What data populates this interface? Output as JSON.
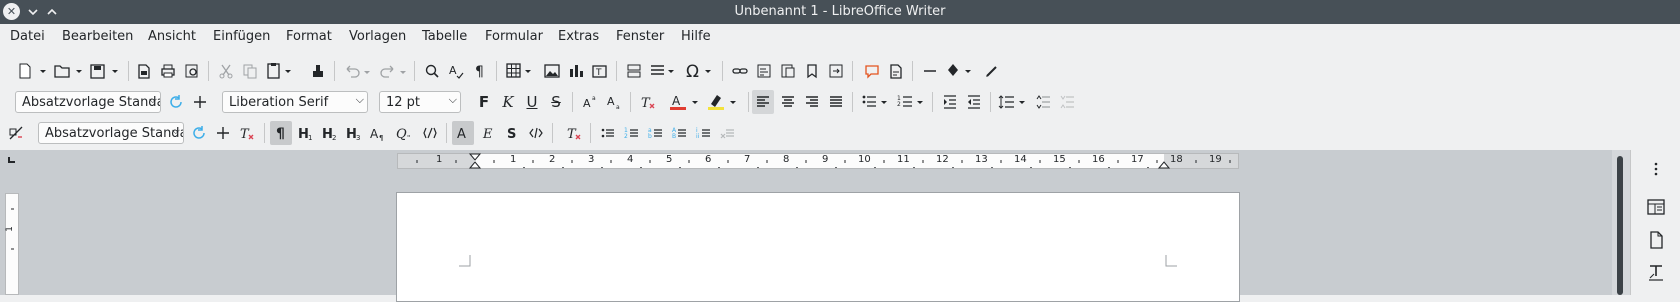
{
  "window": {
    "title": "Unbenannt 1 - LibreOffice Writer"
  },
  "menubar": {
    "items": [
      "Datei",
      "Bearbeiten",
      "Ansicht",
      "Einfügen",
      "Format",
      "Vorlagen",
      "Tabelle",
      "Formular",
      "Extras",
      "Fenster",
      "Hilfe"
    ]
  },
  "formatting_toolbar": {
    "paragraph_style": "Absatzvorlage Standard",
    "font_name": "Liberation Serif",
    "font_size": "12 pt",
    "bold_glyph": "F",
    "italic_glyph": "K",
    "underline_glyph": "U",
    "strike_glyph": "S"
  },
  "sidebar_style_toolbar": {
    "paragraph_style": "Absatzvorlage Standard"
  },
  "ruler": {
    "numbers": [
      "1",
      "1",
      "1",
      "2",
      "3",
      "4",
      "5",
      "6",
      "7",
      "8",
      "9",
      "10",
      "11",
      "12",
      "13",
      "14",
      "15",
      "16",
      "17",
      "18",
      "19"
    ]
  },
  "vertical_ruler": {
    "label": "1"
  },
  "colors": {
    "titlebar": "#475057",
    "menubar": "#eff0f1",
    "workspace": "#c8ccd0",
    "font_color": "#e03c31",
    "highlight": "#f3e23b",
    "comment": "#e3531f"
  }
}
